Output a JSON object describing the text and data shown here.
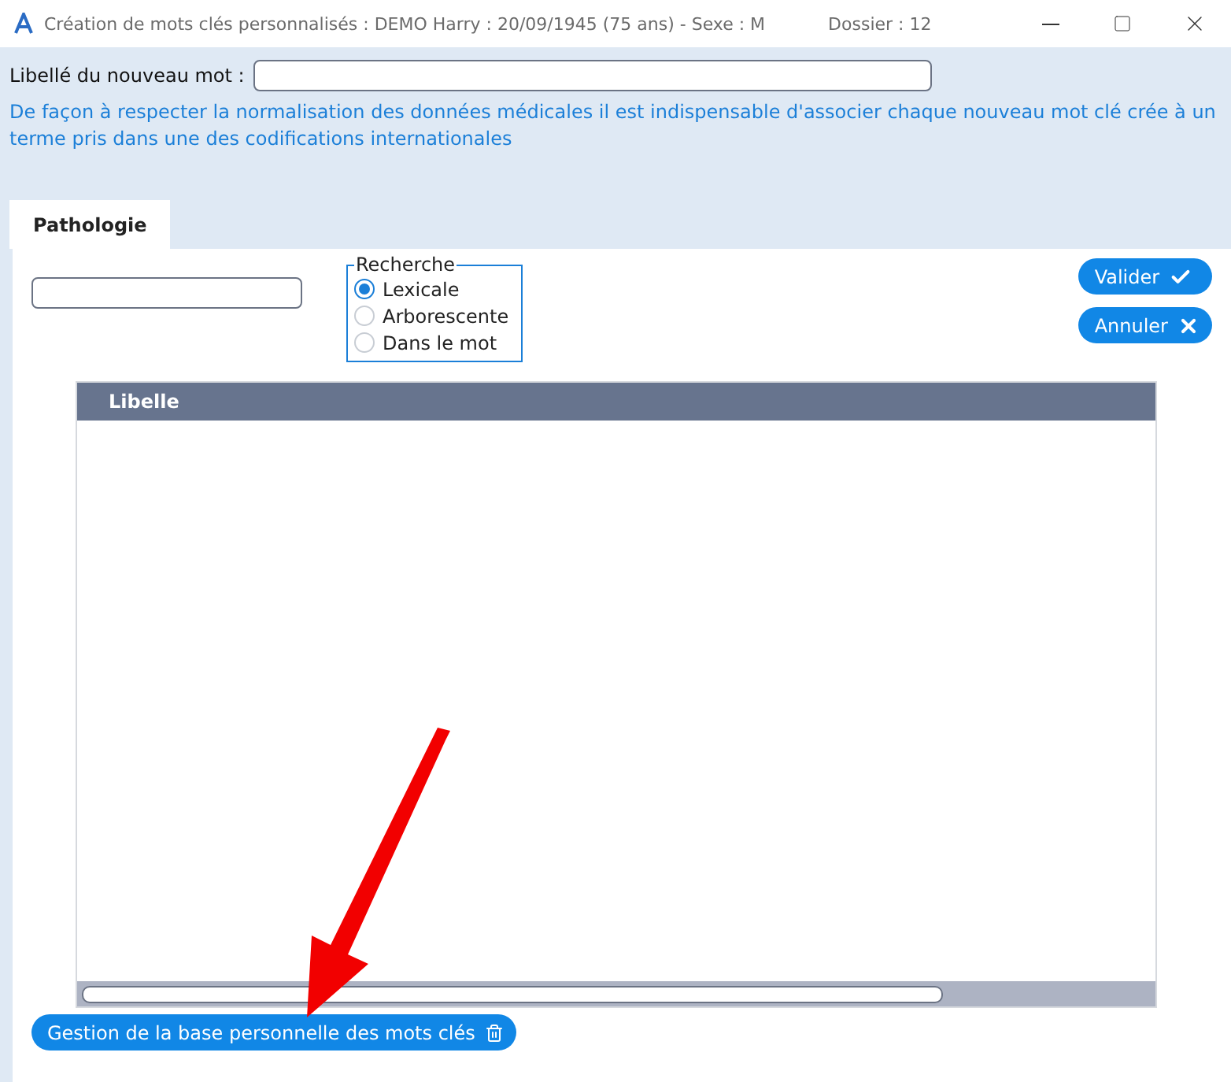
{
  "window": {
    "title": "Création de mots clés personnalisés : DEMO Harry : 20/09/1945 (75 ans) - Sexe : M",
    "dossier": "Dossier : 12"
  },
  "new_word": {
    "label": "Libellé du nouveau mot :"
  },
  "notice": "De façon à respecter la normalisation des données médicales il est indispensable d'associer chaque nouveau mot clé crée à un terme pris dans une des codifications internationales",
  "tabs": [
    {
      "label": "Pathologie",
      "selected": true
    }
  ],
  "recherche": {
    "legend": "Recherche",
    "options": [
      {
        "label": "Lexicale",
        "selected": true
      },
      {
        "label": "Arborescente",
        "selected": false
      },
      {
        "label": "Dans le mot",
        "selected": false
      }
    ]
  },
  "buttons": [
    {
      "label": "Valider",
      "kind": "check"
    },
    {
      "label": "Annuler",
      "kind": "cross"
    }
  ],
  "table": {
    "columns": [
      "Libelle"
    ]
  },
  "bottom_button": {
    "label": "Gestion de la base personnelle des mots clés"
  },
  "annotation": {
    "kind": "arrow"
  }
}
